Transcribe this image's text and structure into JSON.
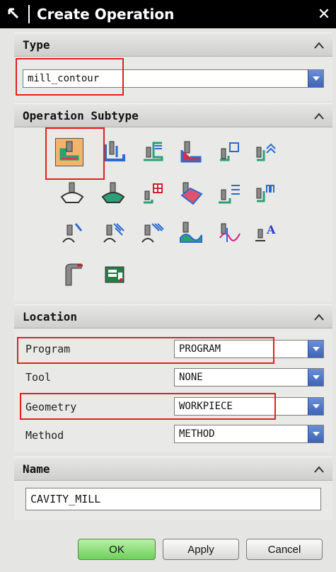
{
  "window": {
    "title": "Create Operation"
  },
  "type_section": {
    "header": "Type",
    "selected": "mill_contour"
  },
  "subtype_section": {
    "header": "Operation Subtype",
    "icons": [
      "cavity-mill-icon",
      "plunge-milling-icon",
      "corner-rough-icon",
      "rest-milling-icon",
      "zlevel-profile-icon",
      "zlevel-corner-icon",
      "fixed-contour-icon",
      "contour-area-icon",
      "contour-surface-area-icon",
      "streamline-icon",
      "contour-area-non-steep-icon",
      "contour-area-dir-steep-icon",
      "flowcut-single-icon",
      "flowcut-multiple-icon",
      "flowcut-ref-tool-icon",
      "solid-profile-3d-icon",
      "contour-profile-icon",
      "contour-text-icon",
      "mill-control-icon",
      "mill-user-icon"
    ],
    "selected_icon": "cavity-mill-icon"
  },
  "location_section": {
    "header": "Location",
    "rows": [
      {
        "label": "Program",
        "value": "PROGRAM"
      },
      {
        "label": "Tool",
        "value": "NONE"
      },
      {
        "label": "Geometry",
        "value": "WORKPIECE"
      },
      {
        "label": "Method",
        "value": "METHOD"
      }
    ]
  },
  "name_section": {
    "header": "Name",
    "value": "CAVITY_MILL"
  },
  "buttons": {
    "ok": "OK",
    "apply": "Apply",
    "cancel": "Cancel"
  },
  "colors": {
    "title_bg": "#000000",
    "highlight": "#e02020",
    "dropdown_arrow": "#3e63b8",
    "ok_button": "#6fcf5a",
    "selected_icon_bg": "#f2b36b"
  }
}
